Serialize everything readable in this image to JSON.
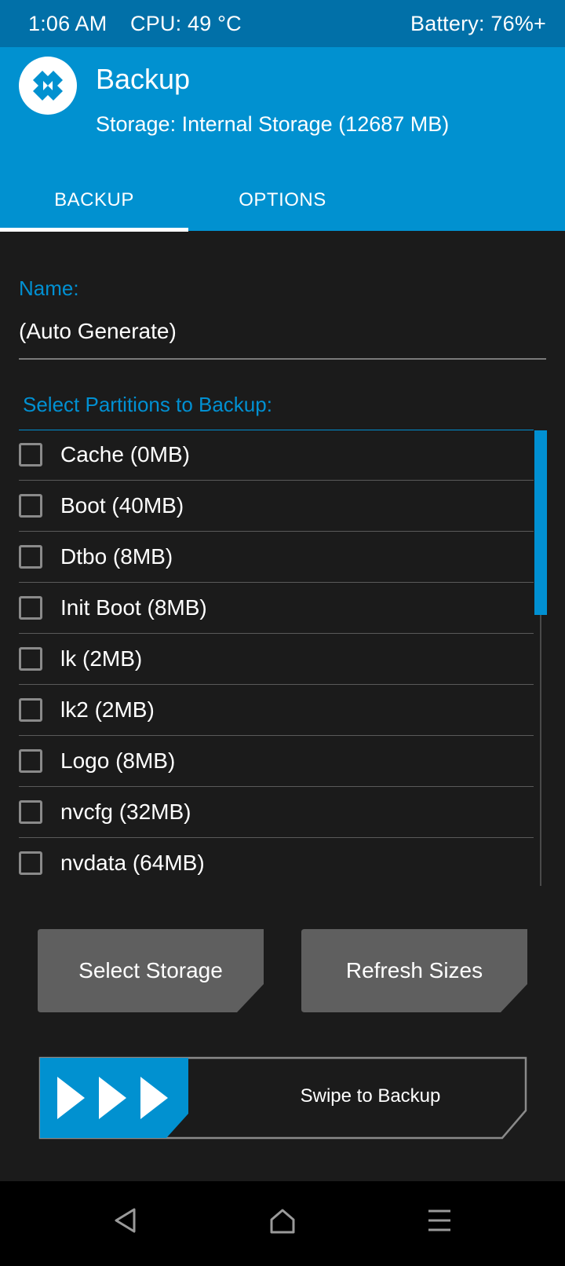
{
  "status_bar": {
    "time": "1:06 AM",
    "cpu": "CPU: 49 °C",
    "battery": "Battery: 76%+"
  },
  "header": {
    "title": "Backup",
    "storage": "Storage: Internal Storage (12687 MB)"
  },
  "tabs": [
    {
      "label": "BACKUP",
      "active": true
    },
    {
      "label": "OPTIONS",
      "active": false
    }
  ],
  "name_field": {
    "label": "Name:",
    "value": "(Auto Generate)"
  },
  "partitions": {
    "label": "Select Partitions to Backup:",
    "items": [
      {
        "label": "Cache (0MB)",
        "checked": false
      },
      {
        "label": "Boot (40MB)",
        "checked": false
      },
      {
        "label": "Dtbo (8MB)",
        "checked": false
      },
      {
        "label": "Init Boot (8MB)",
        "checked": false
      },
      {
        "label": "lk (2MB)",
        "checked": false
      },
      {
        "label": "lk2 (2MB)",
        "checked": false
      },
      {
        "label": "Logo (8MB)",
        "checked": false
      },
      {
        "label": "nvcfg (32MB)",
        "checked": false
      },
      {
        "label": "nvdata (64MB)",
        "checked": false
      }
    ]
  },
  "buttons": {
    "select_storage": "Select Storage",
    "refresh_sizes": "Refresh Sizes"
  },
  "swipe": {
    "label": "Swipe to Backup"
  },
  "nav_icons": [
    "back-icon",
    "home-icon",
    "menu-icon"
  ],
  "colors": {
    "accent": "#0191d0",
    "status_bar": "#0170a8",
    "background": "#1b1b1b",
    "button": "#5f5f5f"
  }
}
